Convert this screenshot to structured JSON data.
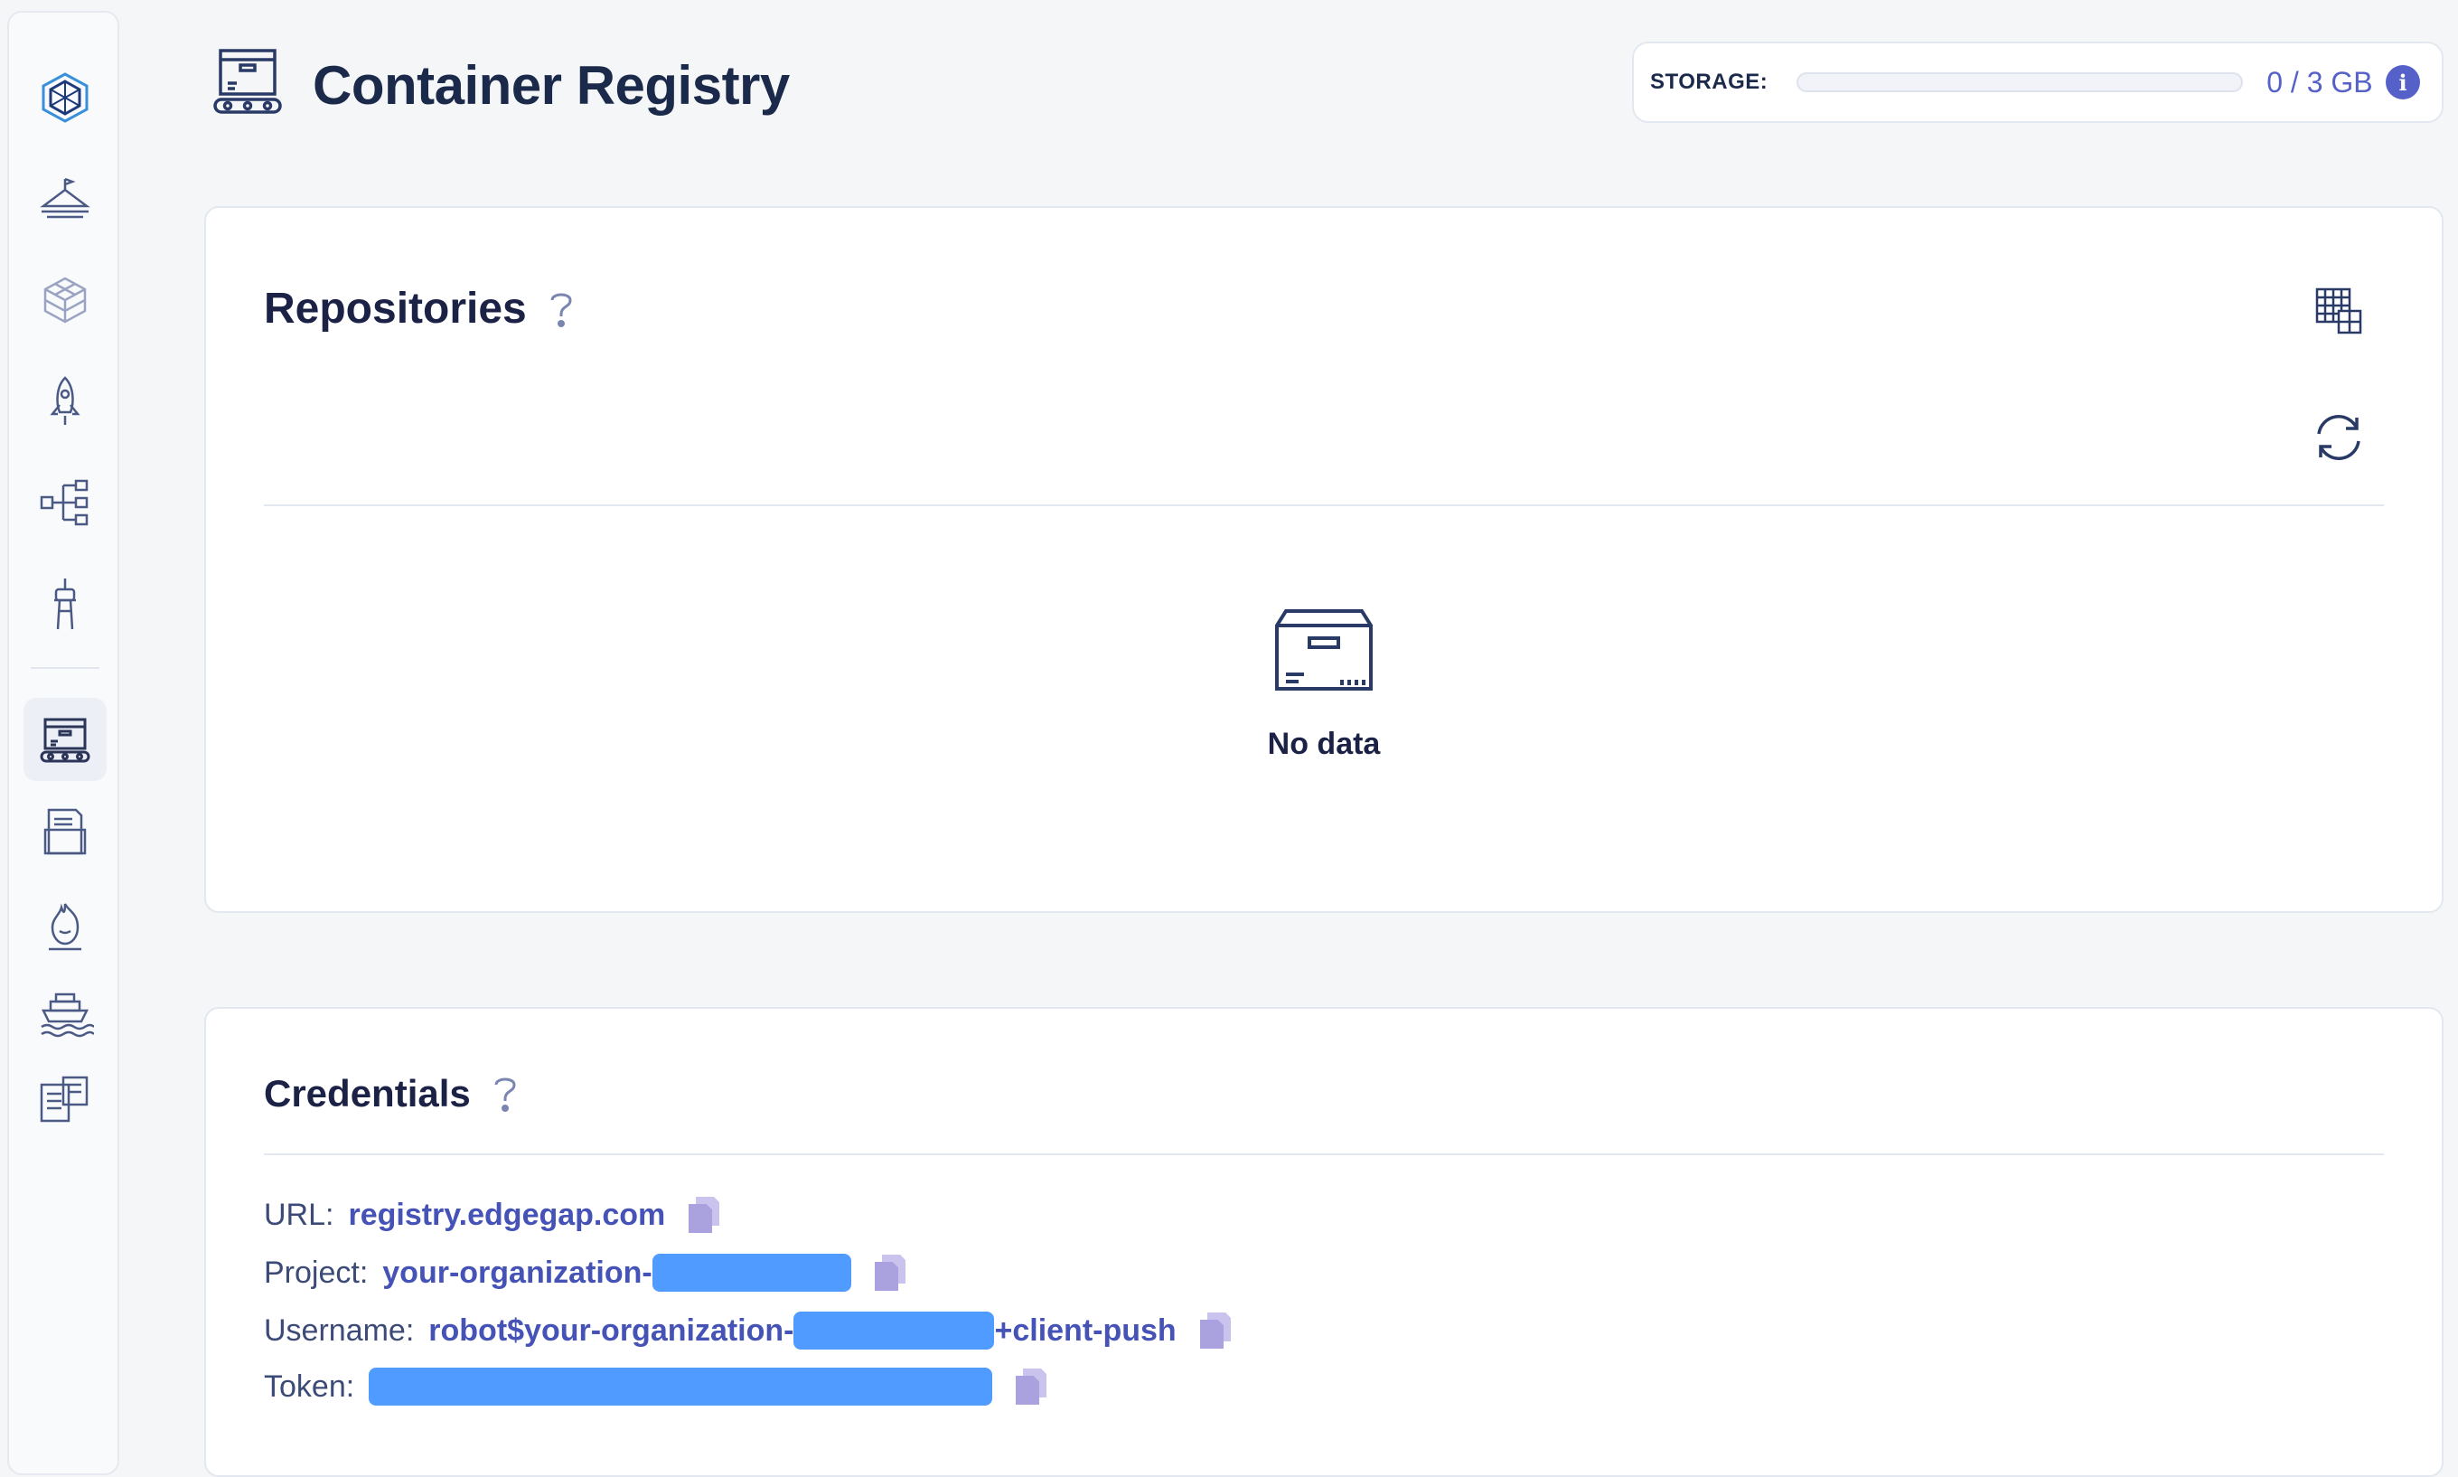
{
  "sidebar": {
    "items": [
      {
        "icon": "cube-logo-icon",
        "active": false
      },
      {
        "icon": "landing-pad-icon",
        "active": false
      },
      {
        "icon": "grid-cube-icon",
        "active": false
      },
      {
        "icon": "rocket-icon",
        "active": false
      },
      {
        "icon": "flow-tree-icon",
        "active": false
      },
      {
        "icon": "tower-icon",
        "active": false
      },
      {
        "icon": "container-registry-icon",
        "active": true
      },
      {
        "icon": "files-icon",
        "active": false
      },
      {
        "icon": "fire-icon",
        "active": false
      },
      {
        "icon": "ship-icon",
        "active": false
      },
      {
        "icon": "docs-icon",
        "active": false
      }
    ]
  },
  "header": {
    "title": "Container Registry",
    "icon": "container-registry-icon"
  },
  "storage": {
    "label": "STORAGE:",
    "value": "0 / 3 GB",
    "used_fraction": 0.0
  },
  "repositories": {
    "title": "Repositories",
    "empty_text": "No data"
  },
  "credentials": {
    "title": "Credentials",
    "url_label": "URL:",
    "url_value": "registry.edgegap.com",
    "project_label": "Project:",
    "project_value_prefix": "your-organization-",
    "username_label": "Username:",
    "username_value_prefix": "robot$your-organization-",
    "username_value_suffix": "+client-push",
    "token_label": "Token:"
  },
  "colors": {
    "accent": "#5561c9",
    "redaction": "#4f9bff",
    "copy_icon": "#a9a2de"
  }
}
